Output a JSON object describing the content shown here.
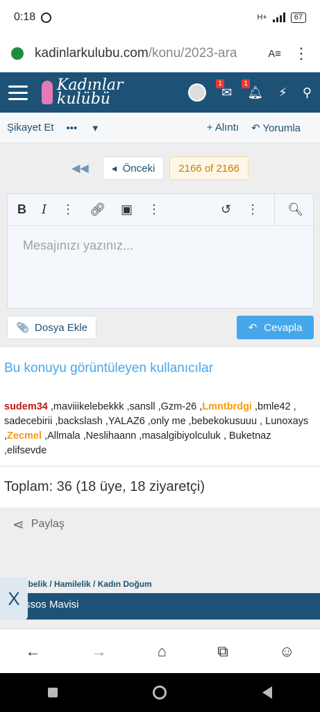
{
  "status": {
    "time": "0:18",
    "battery": "67",
    "network": "H+"
  },
  "browser": {
    "url_host": "kadinlarkulubu.com",
    "url_path": "/konu/2023-ara",
    "translate_label": "A≡"
  },
  "site": {
    "logo_line1": "Kadınlar",
    "logo_line2": "kulübü",
    "messages_badge": "1",
    "alerts_badge": "1"
  },
  "actions": {
    "report": "Şikayet Et",
    "more": "•••",
    "quote": "+ Alıntı",
    "reply": "Yorumla"
  },
  "pager": {
    "prev": "Önceki",
    "current": "2166 of 2166"
  },
  "editor": {
    "placeholder": "Mesajınızı yazınız...",
    "attach": "Dosya Ekle",
    "submit": "Cevapla"
  },
  "viewers": {
    "title": "Bu konuyu görüntüleyen kullanıcılar",
    "user_red": "sudem34",
    "list_a": " ,maviiikelebekkk ,sansll ,Gzm-26 ,",
    "user_orange1": "Lmntbrdgi",
    "list_b": " ,bmle42 , sadecebirii ,backslash ,YALAZ6 ,only me ,bebekokusuuu , Lunoxays ,",
    "user_orange2": "Zecmel",
    "list_c": " ,Allmala ,Neslihaann ,masalgibiyolculuk , Buketnaz ,elifsevde"
  },
  "total": "Toplam: 36 (18 üye, 18 ziyaretçi)",
  "share": "Paylaş",
  "footer": {
    "breadcrumb": "ebelik / Hamilelik / Kadın Doğum",
    "style": "ssos Mavisi",
    "close": "X"
  }
}
